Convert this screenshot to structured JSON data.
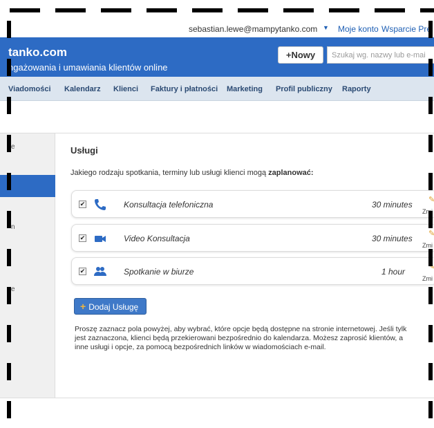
{
  "account": {
    "email": "sebastian.lewe@mampytanko.com",
    "caret": "▼",
    "my_account": "Moje konto",
    "support": "Wsparcie Pre"
  },
  "header": {
    "brand": "tanko.com",
    "tagline": "ngażowania i umawiania klientów online",
    "new_button": "+Nowy",
    "search_placeholder": "Szukaj wg. nazwy lub e-mai",
    "color": "#2d6bc4"
  },
  "nav": {
    "items": [
      "Viadomości",
      "Kalendarz",
      "Klienci",
      "Faktury i płatności",
      "Marketing",
      "Profil publiczny",
      "Raporty"
    ]
  },
  "sidebar": {
    "labels": [
      "e",
      "n",
      "e"
    ]
  },
  "main": {
    "title": "Usługi",
    "question_prefix": "Jakiego rodzaju spotkania, terminy lub usługi klienci mogą ",
    "question_bold": "zaplanować:",
    "services": [
      {
        "name": "Konsultacja telefoniczna",
        "duration": "30 minutes",
        "checked": true,
        "icon": "phone-icon",
        "edit": "Zmi"
      },
      {
        "name": "Video Konsultacja",
        "duration": "30 minutes",
        "checked": true,
        "icon": "video-camera-icon",
        "edit": "Zmi"
      },
      {
        "name": "Spotkanie w biurze",
        "duration": "1 hour",
        "checked": true,
        "icon": "people-icon",
        "edit": "Zmi"
      }
    ],
    "add_button": "Dodaj Usługę",
    "info": "Proszę zaznacz pola powyżej, aby wybrać, które opcje będą dostępne na stronie internetowej. Jeśli tylk\njest zaznaczona, klienci będą przekierowani bezpośrednio do kalendarza. Możesz zaprosić klientów, a\ninne usługi i opcje, za pomocą bezpośrednich linków w wiadomościach e-mail."
  }
}
